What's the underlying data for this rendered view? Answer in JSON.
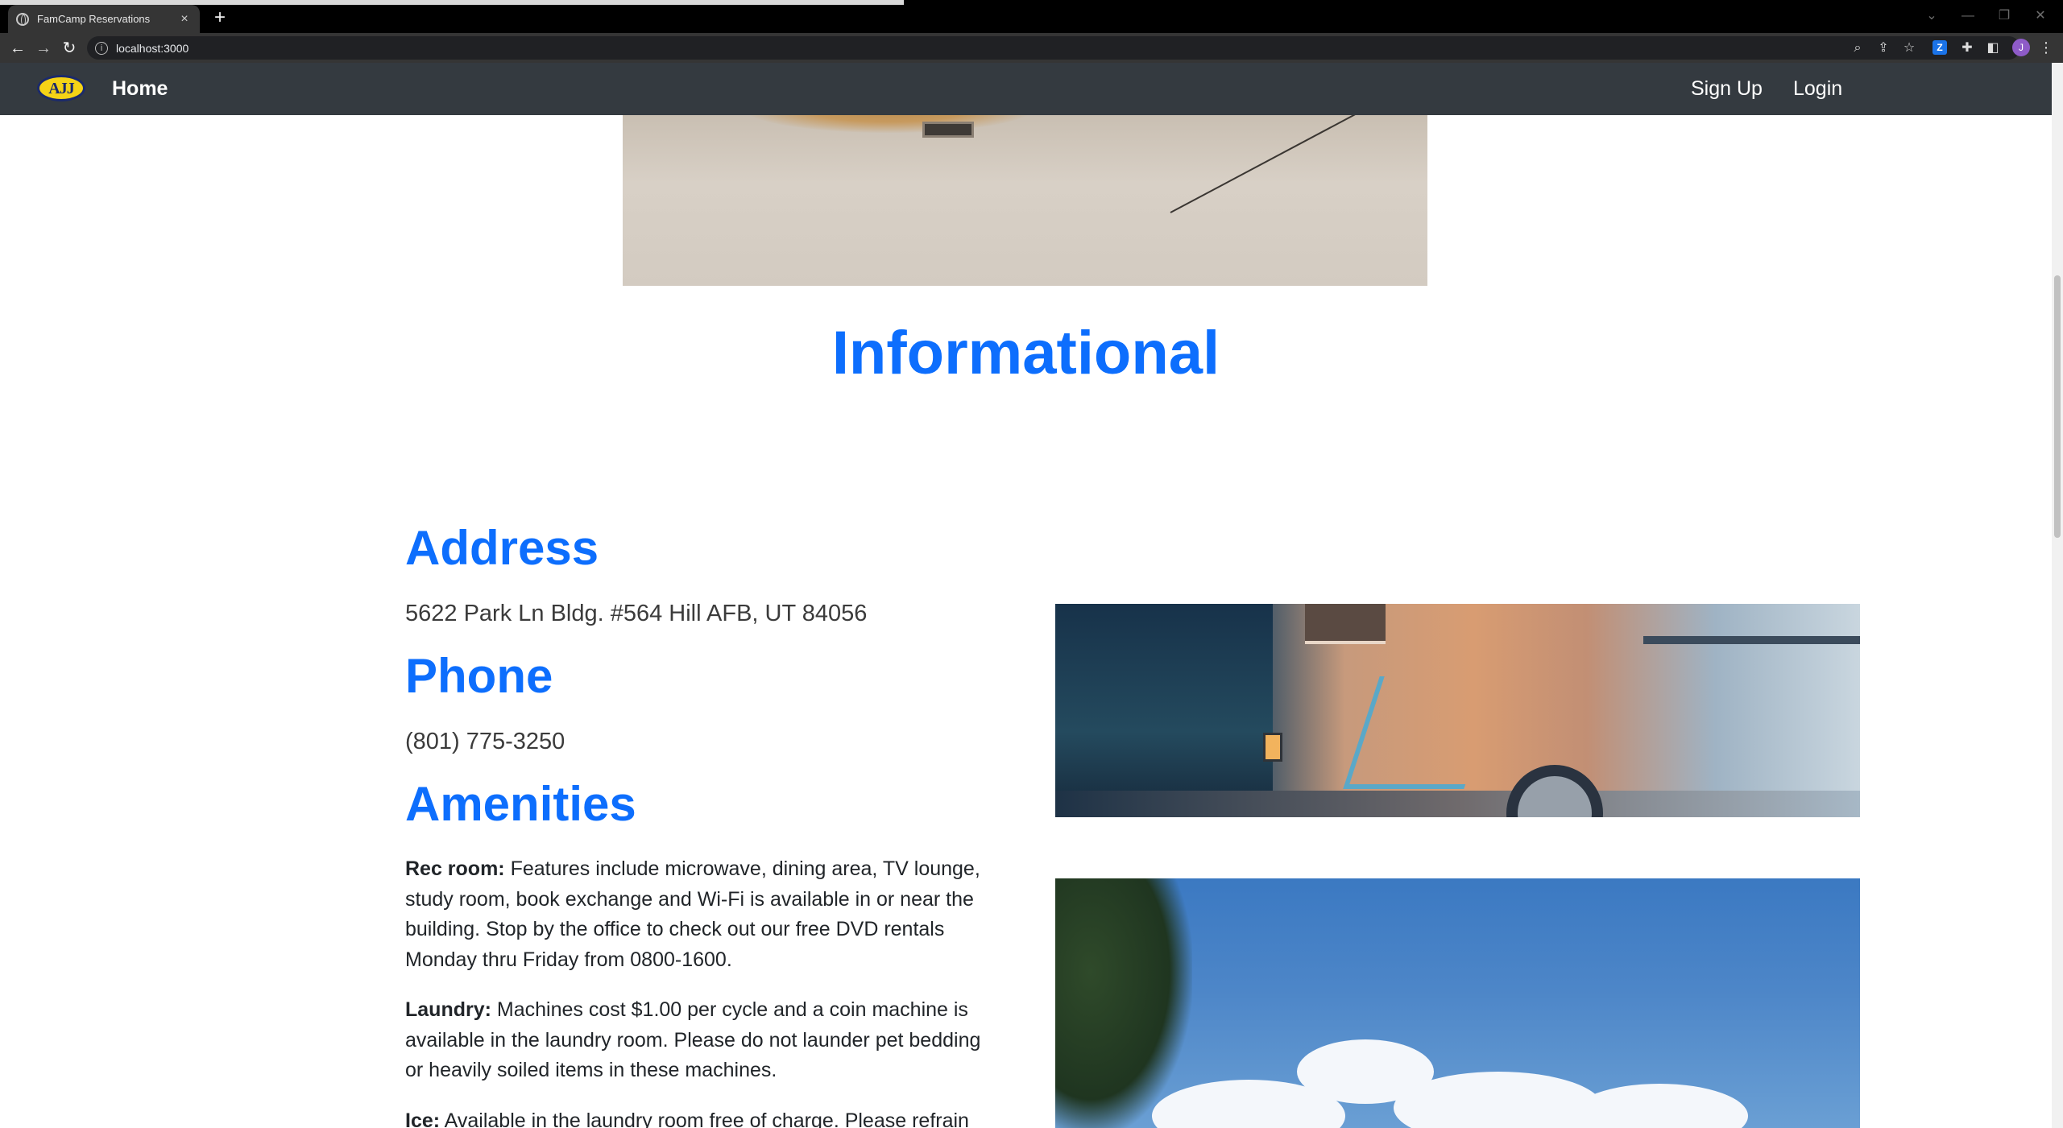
{
  "browser": {
    "tab_title": "FamCamp Reservations",
    "tab_close": "×",
    "new_tab": "+",
    "url": "localhost:3000",
    "info_icon": "i",
    "profile_initial": "J",
    "extension_letter": "Z",
    "menu": "⋮"
  },
  "navbar": {
    "logo_text": "AJJ",
    "home": "Home",
    "signup": "Sign Up",
    "login": "Login"
  },
  "main": {
    "heading": "Informational",
    "address": {
      "title": "Address",
      "text": "5622 Park Ln Bldg. #564 Hill AFB, UT 84056"
    },
    "phone": {
      "title": "Phone",
      "text": "(801) 775-3250"
    },
    "amenities": {
      "title": "Amenities",
      "items": [
        {
          "label": "Rec room:",
          "text": " Features include microwave, dining area, TV lounge, study room, book exchange and Wi-Fi is available in or near the building. Stop by the office to check out our free DVD rentals Monday thru Friday from 0800-1600."
        },
        {
          "label": "Laundry:",
          "text": " Machines cost $1.00 per cycle and a coin machine is available in the laundry room. Please do not launder pet bedding or heavily soiled items in these machines."
        },
        {
          "label": "Ice:",
          "text": " Available in the laundry room free of charge. Please refrain"
        }
      ]
    }
  },
  "colors": {
    "accent": "#0d6efd",
    "navbar_bg": "#343a40",
    "text": "#212529"
  },
  "icons": {
    "back": "back-arrow-icon",
    "forward": "forward-arrow-icon",
    "reload": "reload-icon",
    "zoom": "zoom-icon",
    "share": "share-icon",
    "star": "bookmark-star-icon",
    "extensions": "puzzle-icon",
    "sidepanel": "side-panel-icon"
  }
}
